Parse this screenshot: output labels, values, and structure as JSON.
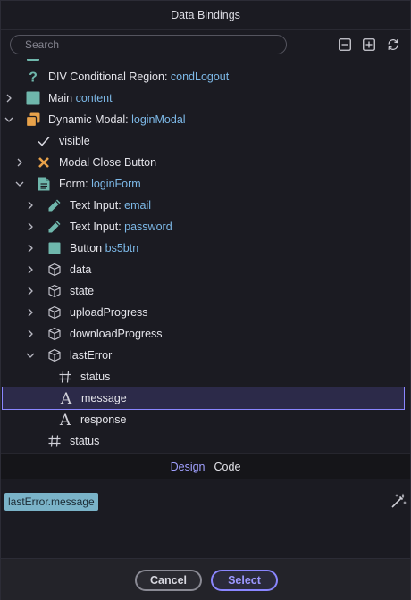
{
  "dialog": {
    "title": "Data Bindings",
    "search": {
      "placeholder": "Search",
      "value": ""
    }
  },
  "tree": {
    "rows": [
      {
        "label": "DIV Conditional Region: ",
        "id": "condLogout",
        "icon": "question-icon",
        "expanded": null
      },
      {
        "label": "Main ",
        "id": "content",
        "icon": "block-icon",
        "expanded": false
      },
      {
        "label": "Dynamic Modal: ",
        "id": "loginModal",
        "icon": "modal-icon",
        "expanded": true
      },
      {
        "label": "visible",
        "id": "",
        "icon": "check-icon",
        "expanded": null
      },
      {
        "label": "Modal Close Button",
        "id": "",
        "icon": "close-x-icon",
        "expanded": false
      },
      {
        "label": "Form: ",
        "id": "loginForm",
        "icon": "form-icon",
        "expanded": true
      },
      {
        "label": "Text Input: ",
        "id": "email",
        "icon": "pencil-icon",
        "expanded": false
      },
      {
        "label": "Text Input: ",
        "id": "password",
        "icon": "pencil-icon",
        "expanded": false
      },
      {
        "label": "Button ",
        "id": "bs5btn",
        "icon": "block-icon",
        "expanded": false
      },
      {
        "label": "data",
        "id": "",
        "icon": "cube-icon",
        "expanded": false
      },
      {
        "label": "state",
        "id": "",
        "icon": "cube-icon",
        "expanded": false
      },
      {
        "label": "uploadProgress",
        "id": "",
        "icon": "cube-icon",
        "expanded": false
      },
      {
        "label": "downloadProgress",
        "id": "",
        "icon": "cube-icon",
        "expanded": false
      },
      {
        "label": "lastError",
        "id": "",
        "icon": "cube-icon",
        "expanded": true
      },
      {
        "label": "status",
        "id": "",
        "icon": "hash-icon",
        "expanded": null
      },
      {
        "label": "message",
        "id": "",
        "icon": "text-type-icon",
        "expanded": null,
        "selected": true
      },
      {
        "label": "response",
        "id": "",
        "icon": "text-type-icon",
        "expanded": null
      },
      {
        "label": "status",
        "id": "",
        "icon": "hash-icon",
        "expanded": null
      }
    ]
  },
  "tabs": {
    "design": "Design",
    "code": "Code",
    "active": "design"
  },
  "editor": {
    "expression": "lastError.message"
  },
  "footer": {
    "cancel": "Cancel",
    "select": "Select"
  },
  "colors": {
    "accent": "#8a86ff",
    "identifier": "#7db9e8",
    "teal_icon": "#6fb7ac",
    "modal_icon": "#e8a24a",
    "chip": "#7ab3c8"
  }
}
